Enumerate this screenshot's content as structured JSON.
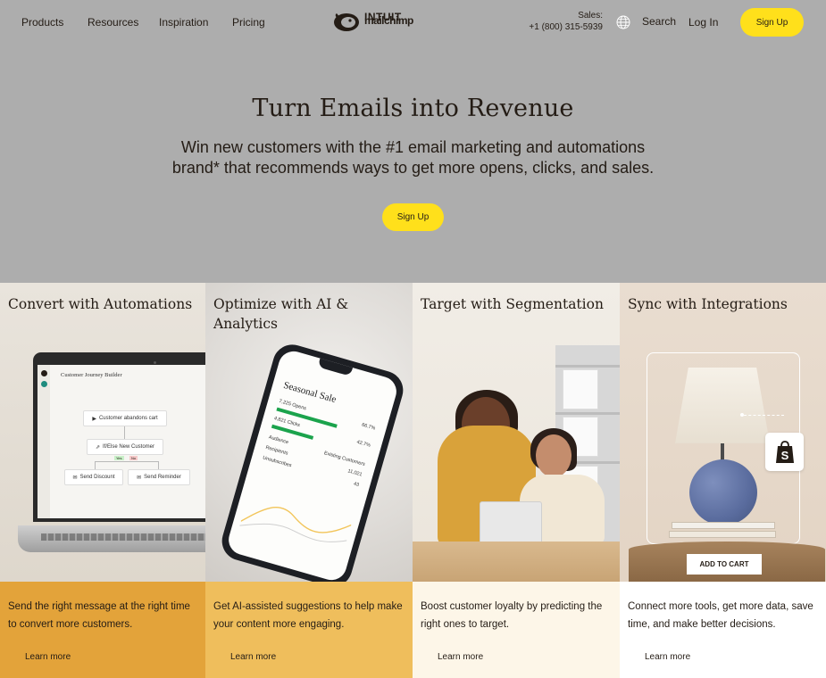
{
  "nav": {
    "links": [
      "Products",
      "Resources",
      "Inspiration",
      "Pricing"
    ],
    "logo_intuit": "INTUIT",
    "logo_word": "mailchimp",
    "sales_label": "Sales:",
    "sales_phone": "+1 (800) 315-5939",
    "search_label": "Search",
    "login_label": "Log In",
    "signup_label": "Sign Up"
  },
  "hero": {
    "title": "Turn Emails into Revenue",
    "subtitle": "Win new customers with the #1 email marketing and automations brand* that recommends ways to get more opens, clicks, and sales.",
    "cta_label": "Sign Up"
  },
  "cards": [
    {
      "title": "Convert with Automations",
      "description": "Send the right message at the right time to convert more customers.",
      "link": "Learn more",
      "bottom_color": "#e3a33a"
    },
    {
      "title": "Optimize with AI & Analytics",
      "description": "Get AI-assisted suggestions to help make your content more engaging.",
      "link": "Learn more",
      "bottom_color": "#efbe5c"
    },
    {
      "title": "Target with Segmentation",
      "description": "Boost customer loyalty by predicting the right ones to target.",
      "link": "Learn more",
      "bottom_color": "#fdf6e8"
    },
    {
      "title": "Sync with Integrations",
      "description": "Connect more tools, get more data, save time, and make better decisions.",
      "link": "Learn more",
      "bottom_color": "#ffffff"
    }
  ],
  "journey": {
    "title": "Customer Journey Builder",
    "trigger": "Customer abandons cart",
    "condition": "If/Else New Customer",
    "yes": "Yes",
    "no": "No",
    "action_left": "Send Discount",
    "action_right": "Send Reminder"
  },
  "phone": {
    "title": "Seasonal Sale",
    "row1_label": "7,225 Opens",
    "row1_value": "66.7%",
    "row2_label": "4,821 Clicks",
    "row2_value": "42.7%",
    "audience_label": "Audience",
    "audience_value": "Existing Customers",
    "recipients_label": "Recipients",
    "recipients_value": "11,021",
    "unsub_label": "Unsubscribes",
    "unsub_value": "43"
  },
  "integrations": {
    "add_to_cart": "ADD TO CART"
  }
}
